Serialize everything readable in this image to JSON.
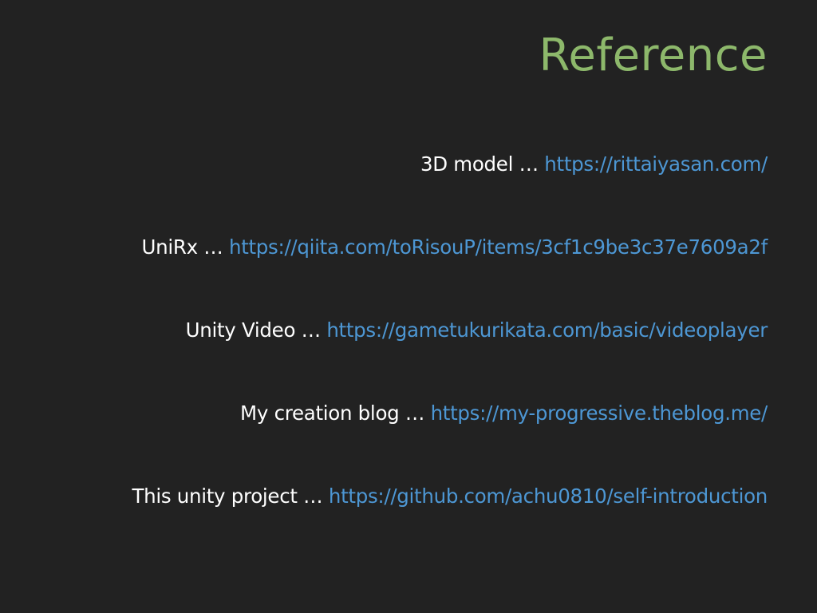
{
  "slide": {
    "title": "Reference",
    "references": [
      {
        "label": "3D model",
        "separator": " … ",
        "url": "https://rittaiyasan.com/"
      },
      {
        "label": "UniRx",
        "separator": " … ",
        "url": "https://qiita.com/toRisouP/items/3cf1c9be3c37e7609a2f"
      },
      {
        "label": "Unity Video",
        "separator": " … ",
        "url": "https://gametukurikata.com/basic/videoplayer"
      },
      {
        "label": "My creation blog",
        "separator": " … ",
        "url": "https://my-progressive.theblog.me/"
      },
      {
        "label": "This unity project",
        "separator": " … ",
        "url": "https://github.com/achu0810/self-introduction"
      }
    ]
  },
  "colors": {
    "background": "#222222",
    "title": "#8db86b",
    "label": "#ffffff",
    "link": "#4d97d4"
  }
}
